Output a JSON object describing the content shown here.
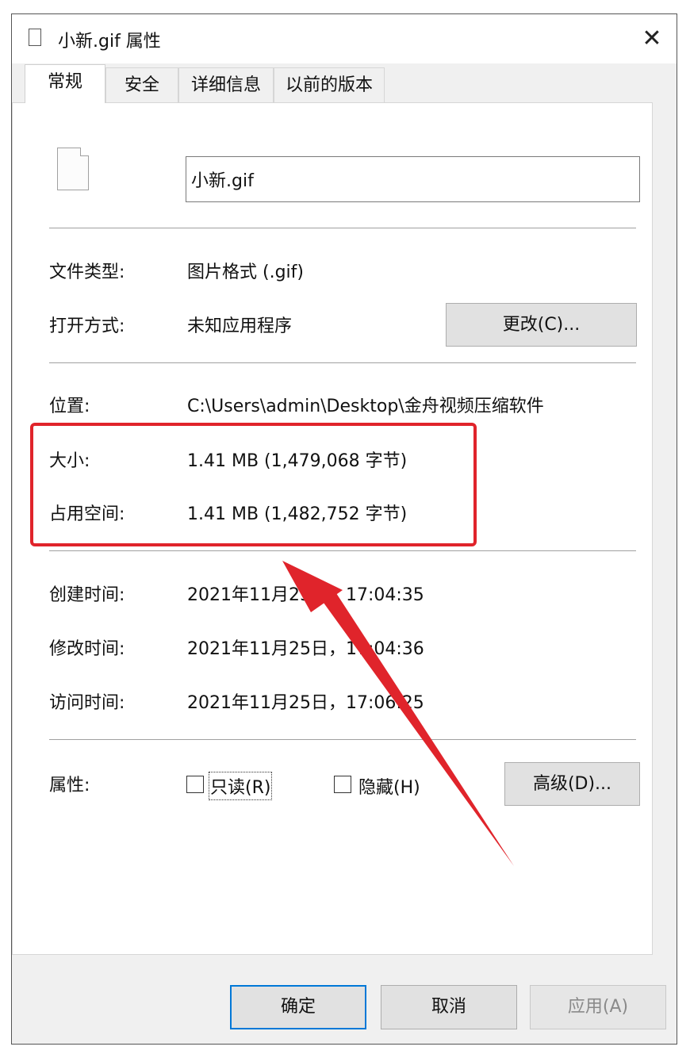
{
  "window": {
    "title": "小新.gif 属性",
    "close_glyph": "✕"
  },
  "tabs": [
    {
      "label": "常规",
      "active": true
    },
    {
      "label": "安全",
      "active": false
    },
    {
      "label": "详细信息",
      "active": false
    },
    {
      "label": "以前的版本",
      "active": false
    }
  ],
  "general": {
    "file_name": "小新.gif",
    "file_type": {
      "label": "文件类型:",
      "value": "图片格式 (.gif)"
    },
    "opens_with": {
      "label": "打开方式:",
      "value": "未知应用程序",
      "change_button": "更改(C)..."
    },
    "location": {
      "label": "位置:",
      "value": "C:\\Users\\admin\\Desktop\\金舟视频压缩软件"
    },
    "size": {
      "label": "大小:",
      "value": "1.41 MB (1,479,068 字节)"
    },
    "size_on_disk": {
      "label": "占用空间:",
      "value": "1.41 MB (1,482,752 字节)"
    },
    "created": {
      "label": "创建时间:",
      "value": "2021年11月25日，17:04:35"
    },
    "modified": {
      "label": "修改时间:",
      "value": "2021年11月25日，17:04:36"
    },
    "accessed": {
      "label": "访问时间:",
      "value": "2021年11月25日，17:06:25"
    },
    "attributes": {
      "label": "属性:",
      "readonly": {
        "label": "只读(R)",
        "checked": false
      },
      "hidden": {
        "label": "隐藏(H)",
        "checked": false
      },
      "advanced_button": "高级(D)..."
    }
  },
  "footer": {
    "ok": "确定",
    "cancel": "取消",
    "apply": "应用(A)"
  },
  "annotation": {
    "highlight_color": "#e0242b"
  }
}
